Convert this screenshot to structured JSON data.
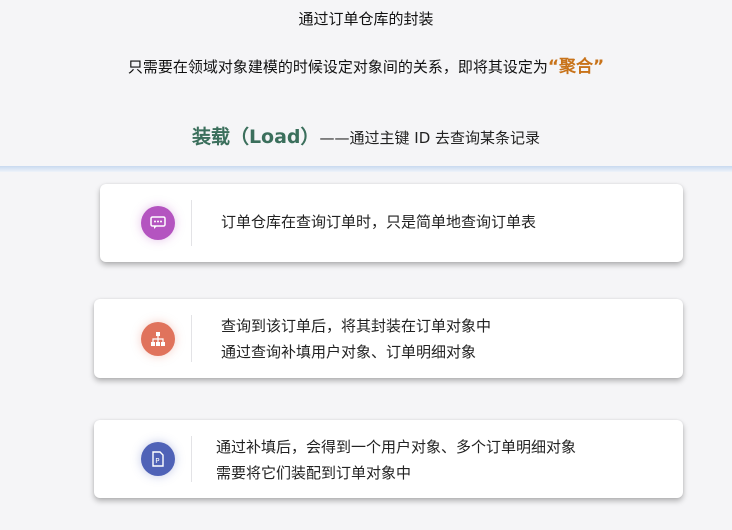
{
  "header": {
    "title": "通过订单仓库的封装",
    "subtitle_prefix": "只需要在领域对象建模的时候设定对象间的关系，即将其设定为",
    "subtitle_highlight": "“聚合”",
    "load_accent": "装载（Load）",
    "load_rest": "——通过主键 ID 去查询某条记录"
  },
  "cards": [
    {
      "icon": "chat-bubble-icon",
      "color": "#b454c0",
      "line1": "订单仓库在查询订单时，只是简单地查询订单表",
      "line2": ""
    },
    {
      "icon": "org-chart-icon",
      "color": "#e0735c",
      "line1": "查询到该订单后，将其封装在订单对象中",
      "line2": "通过查询补填用户对象、订单明细对象"
    },
    {
      "icon": "document-icon",
      "color": "#4f62b7",
      "line1": "通过补填后，会得到一个用户对象、多个订单明细对象",
      "line2": "需要将它们装配到订单对象中"
    }
  ]
}
